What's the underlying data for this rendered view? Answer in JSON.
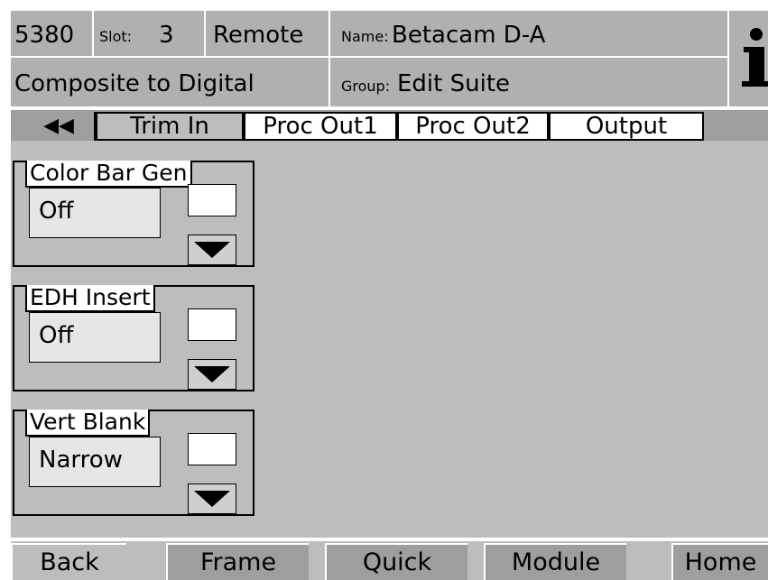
{
  "header": {
    "model": "5380",
    "slot_label": "Slot:",
    "slot_value": "3",
    "mode": "Remote",
    "name_label": "Name:",
    "name_value": "Betacam D-A",
    "description": "Composite to Digital",
    "group_label": "Group:",
    "group_value": "Edit Suite",
    "info_icon": "info-icon"
  },
  "tabs": [
    {
      "label": "◀◀"
    },
    {
      "label": "Trim In"
    },
    {
      "label": "Proc Out1"
    },
    {
      "label": "Proc Out2"
    },
    {
      "label": "Output"
    }
  ],
  "groups": [
    {
      "label": "Color Bar Gen",
      "value": "Off"
    },
    {
      "label": "EDH Insert",
      "value": "Off"
    },
    {
      "label": "Vert Blank",
      "value": "Narrow"
    }
  ],
  "bottom_buttons": [
    {
      "label": "Back"
    },
    {
      "label": "Frame"
    },
    {
      "label": "Quick"
    },
    {
      "label": "Module"
    },
    {
      "label": "Home"
    }
  ]
}
